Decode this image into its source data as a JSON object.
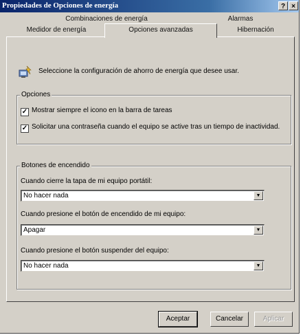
{
  "window": {
    "title": "Propiedades de Opciones de energía",
    "help_glyph": "?",
    "close_glyph": "×"
  },
  "tabs": {
    "row1": [
      "Combinaciones de energía",
      "Alarmas"
    ],
    "row2": [
      "Medidor de energía",
      "Opciones avanzadas",
      "Hibernación"
    ],
    "active": "Opciones avanzadas"
  },
  "intro": {
    "icon": "power-settings-icon",
    "text": "Seleccione la configuración de ahorro de energía que desee usar."
  },
  "options": {
    "legend": "Opciones",
    "items": [
      {
        "label": "Mostrar siempre el icono en la barra de tareas",
        "checked": true
      },
      {
        "label": "Solicitar una contraseña cuando el equipo se active tras un tiempo de inactividad.",
        "checked": true
      }
    ]
  },
  "power_buttons": {
    "legend": "Botones de encendido",
    "fields": [
      {
        "label": "Cuando cierre la tapa de mi equipo portátil:",
        "value": "No hacer nada"
      },
      {
        "label": "Cuando presione el botón de encendido de mi equipo:",
        "value": "Apagar"
      },
      {
        "label": "Cuando presione el botón suspender del  equipo:",
        "value": "No hacer nada"
      }
    ]
  },
  "buttons": {
    "ok": "Aceptar",
    "cancel": "Cancelar",
    "apply": "Aplicar"
  },
  "check_glyph": "✓",
  "dropdown_glyph": "▼"
}
